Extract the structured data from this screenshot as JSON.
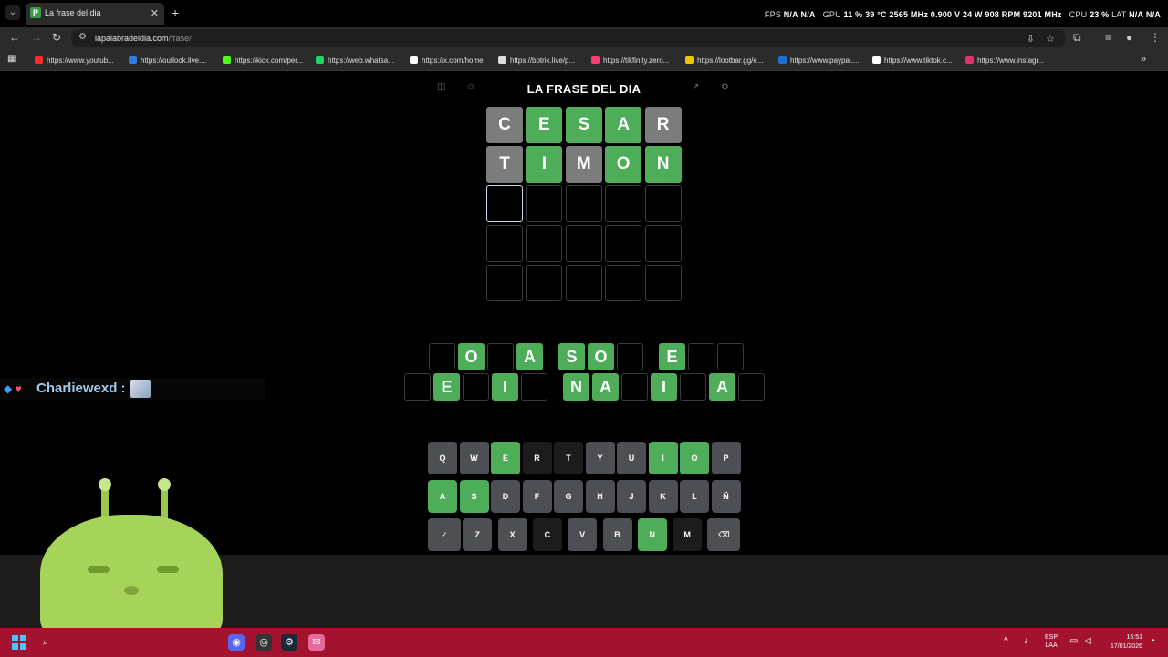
{
  "browser": {
    "tab_title": "La frase del dia",
    "tab_favicon": "P",
    "url_host": "lapalabradeldia.com",
    "url_path": "/frase/",
    "bookmarks": [
      "https://www.youtub...",
      "https://outlook.live....",
      "https://kick.com/per...",
      "https://web.whatsa...",
      "https://x.com/home",
      "https://botrix.live/p...",
      "https://tikfinity.zero...",
      "https://lootbar.gg/e...",
      "https://www.paypal....",
      "https://www.tiktok.c...",
      "https://www.instagr..."
    ],
    "bookmark_colors": [
      "#ff2b2b",
      "#2f7bdf",
      "#53fc18",
      "#25d366",
      "#ffffff",
      "#dddddd",
      "#ff3c78",
      "#f2c200",
      "#1f6fd1",
      "#ffffff",
      "#e1306c"
    ]
  },
  "overlay": {
    "fps_label": "FPS",
    "fps_value": "N/A",
    "fps_value2": "N/A",
    "gpu_label": "GPU",
    "gpu_load": "11 %",
    "gpu_temp": "39 °C",
    "gpu_clock": "2565 MHz",
    "gpu_volt": "0.900 V",
    "gpu_power": "24 W",
    "gpu_fan": "908 RPM",
    "gpu_mem": "9201 MHz",
    "cpu_label": "CPU",
    "cpu_load": "23 %",
    "lat_label": "LAT",
    "lat_value": "N/A",
    "lat_value2": "N/A"
  },
  "page": {
    "title": "LA FRASE DEL DIA"
  },
  "board": [
    [
      {
        "l": "C",
        "s": "gray"
      },
      {
        "l": "E",
        "s": "green"
      },
      {
        "l": "S",
        "s": "green"
      },
      {
        "l": "A",
        "s": "green"
      },
      {
        "l": "R",
        "s": "gray"
      }
    ],
    [
      {
        "l": "T",
        "s": "gray"
      },
      {
        "l": "I",
        "s": "green"
      },
      {
        "l": "M",
        "s": "gray"
      },
      {
        "l": "O",
        "s": "green"
      },
      {
        "l": "N",
        "s": "green"
      }
    ],
    [
      {
        "l": "",
        "s": "active"
      },
      {
        "l": "",
        "s": "empty"
      },
      {
        "l": "",
        "s": "empty"
      },
      {
        "l": "",
        "s": "empty"
      },
      {
        "l": "",
        "s": "empty"
      }
    ],
    [
      {
        "l": "",
        "s": "empty"
      },
      {
        "l": "",
        "s": "empty"
      },
      {
        "l": "",
        "s": "empty"
      },
      {
        "l": "",
        "s": "empty"
      },
      {
        "l": "",
        "s": "empty"
      }
    ],
    [
      {
        "l": "",
        "s": "empty"
      },
      {
        "l": "",
        "s": "empty"
      },
      {
        "l": "",
        "s": "empty"
      },
      {
        "l": "",
        "s": "empty"
      },
      {
        "l": "",
        "s": "empty"
      }
    ]
  ],
  "phrase": {
    "line1": [
      "",
      "O",
      "",
      "A",
      " ",
      "S",
      "O",
      "",
      " ",
      "E",
      "",
      ""
    ],
    "line2": [
      "",
      "E",
      "",
      "I",
      "",
      " ",
      "N",
      "A",
      "",
      "I",
      "",
      "A",
      ""
    ]
  },
  "keyboard": [
    [
      {
        "k": "Q",
        "s": "normal"
      },
      {
        "k": "W",
        "s": "normal"
      },
      {
        "k": "E",
        "s": "green"
      },
      {
        "k": "R",
        "s": "dark"
      },
      {
        "k": "T",
        "s": "dark"
      },
      {
        "k": "Y",
        "s": "normal"
      },
      {
        "k": "U",
        "s": "normal"
      },
      {
        "k": "I",
        "s": "green"
      },
      {
        "k": "O",
        "s": "green"
      },
      {
        "k": "P",
        "s": "normal"
      }
    ],
    [
      {
        "k": "A",
        "s": "green"
      },
      {
        "k": "S",
        "s": "green"
      },
      {
        "k": "D",
        "s": "normal"
      },
      {
        "k": "F",
        "s": "normal"
      },
      {
        "k": "G",
        "s": "normal"
      },
      {
        "k": "H",
        "s": "normal"
      },
      {
        "k": "J",
        "s": "normal"
      },
      {
        "k": "K",
        "s": "normal"
      },
      {
        "k": "L",
        "s": "normal"
      },
      {
        "k": "Ñ",
        "s": "normal"
      }
    ],
    [
      {
        "k": "✓",
        "s": "normal"
      },
      {
        "k": "Z",
        "s": "normal"
      },
      {
        "k": "X",
        "s": "normal"
      },
      {
        "k": "C",
        "s": "dark"
      },
      {
        "k": "V",
        "s": "normal"
      },
      {
        "k": "B",
        "s": "normal"
      },
      {
        "k": "N",
        "s": "green"
      },
      {
        "k": "M",
        "s": "dark"
      },
      {
        "k": "⌫",
        "s": "normal"
      }
    ]
  ],
  "chat": {
    "username": "Charliewexd :",
    "badges": "◆ ♦"
  },
  "taskbar": {
    "lang_top": "ESP",
    "lang_bottom": "LAA",
    "time": "16:51",
    "date": "17/01/2026",
    "accent": "#a3122f"
  },
  "colors": {
    "correct": "#4ead58",
    "absent": "#7c7c7c"
  }
}
